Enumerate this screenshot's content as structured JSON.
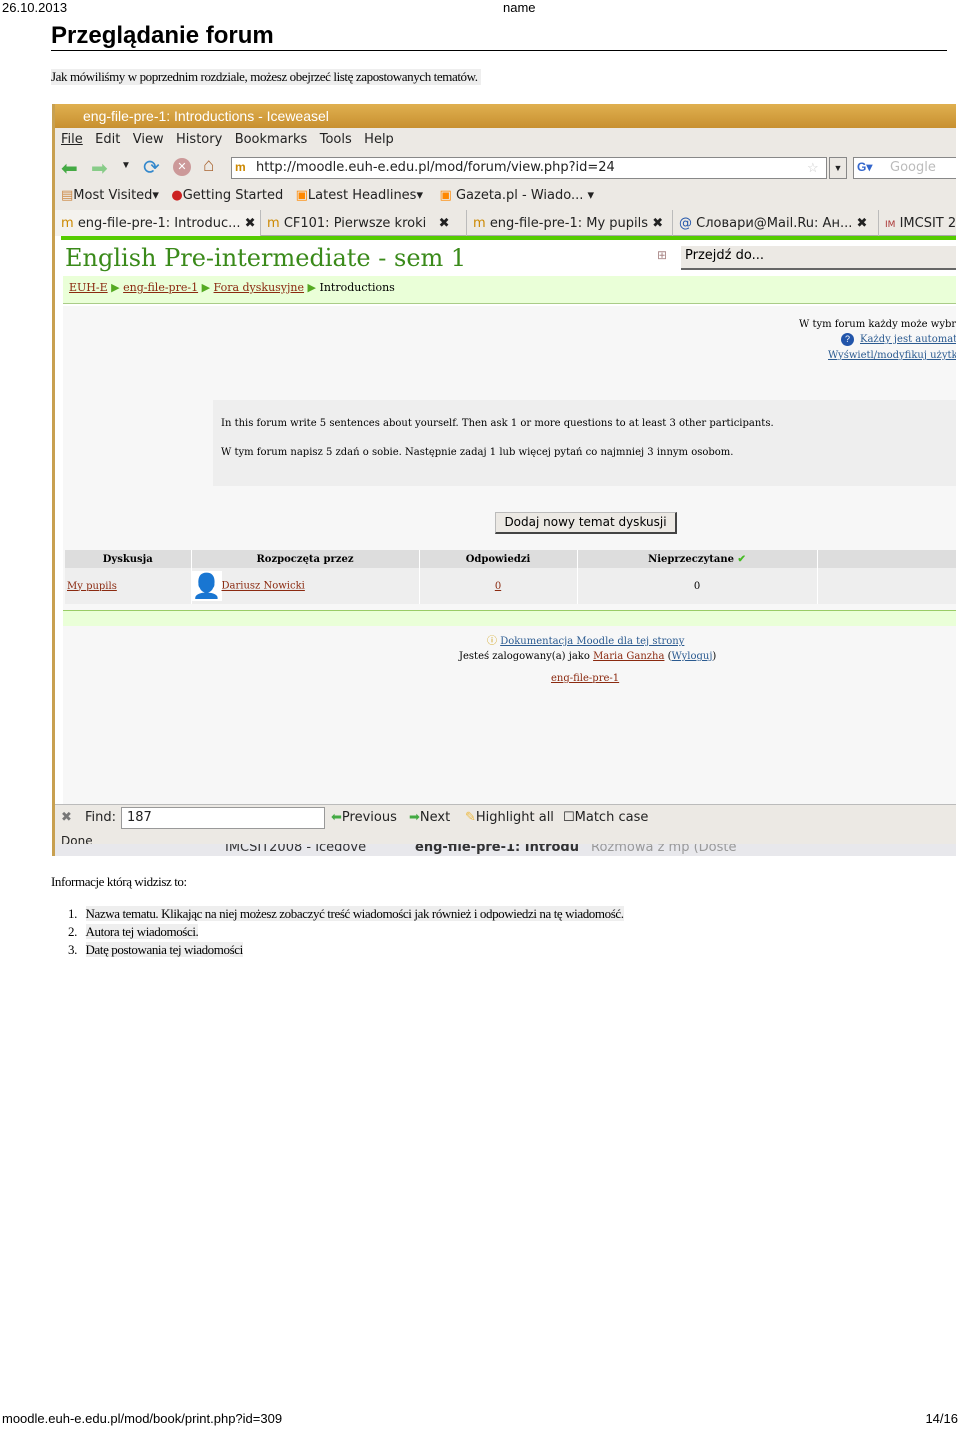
{
  "print_header": {
    "date": "26.10.2013",
    "name": "name"
  },
  "page_title": "Przeglądanie forum",
  "intro": "Jak mówiliśmy w poprzednim rozdziale, możesz obejrzeć listę zapostowanych tematów.",
  "browser": {
    "window_title": "eng-file-pre-1: Introductions - Iceweasel",
    "menu": [
      "File",
      "Edit",
      "View",
      "History",
      "Bookmarks",
      "Tools",
      "Help"
    ],
    "url": "http://moodle.euh-e.edu.pl/mod/forum/view.php?id=24",
    "search_placeholder": "Google",
    "bookmarks": [
      "Most Visited",
      "Getting Started",
      "Latest Headlines",
      "Gazeta.pl - Wiado..."
    ],
    "tabs": [
      "eng-file-pre-1: Introduc...",
      "CF101: Pierwsze kroki",
      "eng-file-pre-1: My pupils",
      "Словари@Mail.Ru: Ан...",
      "IMCSIT 2"
    ],
    "find_label": "Find:",
    "find_value": "187",
    "find_prev": "Previous",
    "find_next": "Next",
    "find_highlight": "Highlight all",
    "find_match": "Match case",
    "status": "Done",
    "taskbar": [
      "IMCSIT2008 - Icedove",
      "eng-file-pre-1: Introdu",
      "Rozmowa z mp (Doste"
    ]
  },
  "moodle": {
    "course_title": "English Pre-intermediate - sem 1",
    "jump": "Przejdź do...",
    "breadcrumb": [
      "EUH-E",
      "eng-file-pre-1",
      "Fora dyskusyjne",
      "Introductions"
    ],
    "sub_info": "W tym forum każdy może wybrać",
    "sub_auto": "Każdy jest automaty",
    "sub_view": "Wyświetl/modyfikuj użytko",
    "intro_en": "In this forum write 5 sentences about yourself. Then ask 1 or more questions to at least 3 other participants.",
    "intro_pl": "W tym forum napisz 5 zdań o sobie. Następnie zadaj 1 lub więcej pytań co najmniej 3 innym osobom.",
    "add_button": "Dodaj nowy temat dyskusji",
    "columns": [
      "Dyskusja",
      "Rozpoczęta przez",
      "Odpowiedzi",
      "Nieprzeczytane"
    ],
    "rows": [
      {
        "discussion": "My pupils",
        "author": "Dariusz Nowicki",
        "replies": "0",
        "unread": "0"
      }
    ],
    "docs": "Dokumentacja Moodle dla tej strony",
    "logged_prefix": "Jesteś zalogowany(a) jako",
    "user": "Maria Ganzha",
    "logout": "Wyloguj",
    "footer_course": "eng-file-pre-1"
  },
  "after_label": "Informacje którą widzisz to:",
  "list": [
    "Nazwa tematu. Klikając na niej możesz zobaczyć treść wiadomości jak również i odpowiedzi na tę wiadomość.",
    "Autora tej wiadomości.",
    "Datę postowania tej wiadomości"
  ],
  "print_footer": {
    "url": "moodle.euh-e.edu.pl/mod/book/print.php?id=309",
    "page": "14/16"
  }
}
